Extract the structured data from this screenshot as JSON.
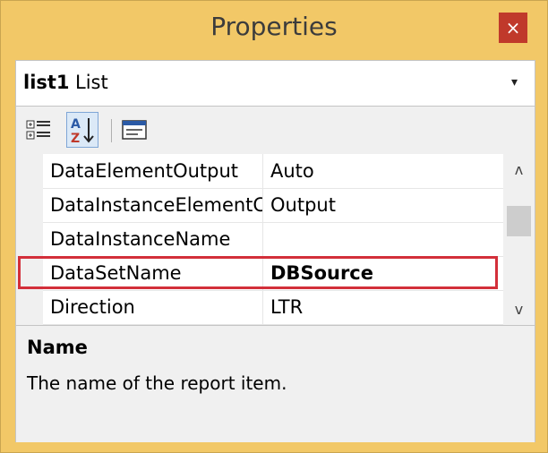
{
  "window": {
    "title": "Properties",
    "close_glyph": "×"
  },
  "object_selector": {
    "name": "list1",
    "type": "List",
    "dropdown_glyph": "▾"
  },
  "toolbar": [
    {
      "icon": "categorized-icon"
    },
    {
      "icon": "alphabetical-sort-icon",
      "active": true
    },
    {
      "icon": "property-pages-icon"
    }
  ],
  "properties": [
    {
      "name": "DataElementOutput",
      "value": "Auto"
    },
    {
      "name": "DataInstanceElementC",
      "value": "Output"
    },
    {
      "name": "DataInstanceName",
      "value": ""
    },
    {
      "name": "DataSetName",
      "value": "DBSource",
      "highlighted": true
    },
    {
      "name": "Direction",
      "value": "LTR"
    }
  ],
  "scrollbar": {
    "up_glyph": "ʌ",
    "down_glyph": "v"
  },
  "description": {
    "title": "Name",
    "text": "The name of the report item."
  },
  "colors": {
    "window_frame": "#f2c867",
    "close_button": "#c0392b",
    "highlight": "#d32f3a"
  }
}
